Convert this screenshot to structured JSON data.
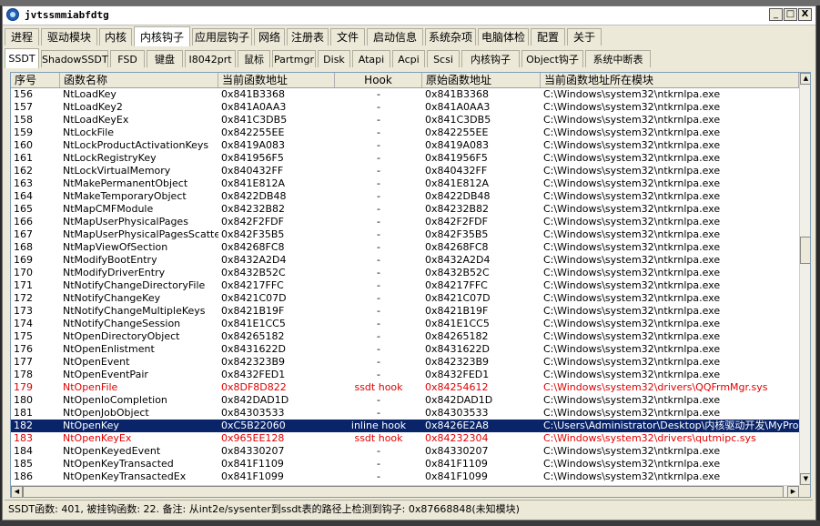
{
  "window": {
    "title": "jvtssmmiabfdtg"
  },
  "menu_tabs": [
    "进程",
    "驱动模块",
    "内核",
    "内核钩子",
    "应用层钩子",
    "网络",
    "注册表",
    "文件",
    "启动信息",
    "系统杂项",
    "电脑体检",
    "配置",
    "关于"
  ],
  "active_menu_tab": "内核钩子",
  "sub_tabs": [
    "SSDT",
    "ShadowSSDT",
    "FSD",
    "键盘",
    "I8042prt",
    "鼠标",
    "Partmgr",
    "Disk",
    "Atapi",
    "Acpi",
    "Scsi",
    "内核钩子",
    "Object钩子",
    "系统中断表"
  ],
  "active_sub_tab": "SSDT",
  "columns": [
    "序号",
    "函数名称",
    "当前函数地址",
    "Hook",
    "原始函数地址",
    "当前函数地址所在模块"
  ],
  "rows": [
    {
      "idx": "156",
      "name": "NtLoadKey",
      "cur": "0x841B3368",
      "hook": "-",
      "orig": "0x841B3368",
      "module": "C:\\Windows\\system32\\ntkrnlpa.exe",
      "state": "normal"
    },
    {
      "idx": "157",
      "name": "NtLoadKey2",
      "cur": "0x841A0AA3",
      "hook": "-",
      "orig": "0x841A0AA3",
      "module": "C:\\Windows\\system32\\ntkrnlpa.exe",
      "state": "normal"
    },
    {
      "idx": "158",
      "name": "NtLoadKeyEx",
      "cur": "0x841C3DB5",
      "hook": "-",
      "orig": "0x841C3DB5",
      "module": "C:\\Windows\\system32\\ntkrnlpa.exe",
      "state": "normal"
    },
    {
      "idx": "159",
      "name": "NtLockFile",
      "cur": "0x842255EE",
      "hook": "-",
      "orig": "0x842255EE",
      "module": "C:\\Windows\\system32\\ntkrnlpa.exe",
      "state": "normal"
    },
    {
      "idx": "160",
      "name": "NtLockProductActivationKeys",
      "cur": "0x8419A083",
      "hook": "-",
      "orig": "0x8419A083",
      "module": "C:\\Windows\\system32\\ntkrnlpa.exe",
      "state": "normal"
    },
    {
      "idx": "161",
      "name": "NtLockRegistryKey",
      "cur": "0x841956F5",
      "hook": "-",
      "orig": "0x841956F5",
      "module": "C:\\Windows\\system32\\ntkrnlpa.exe",
      "state": "normal"
    },
    {
      "idx": "162",
      "name": "NtLockVirtualMemory",
      "cur": "0x840432FF",
      "hook": "-",
      "orig": "0x840432FF",
      "module": "C:\\Windows\\system32\\ntkrnlpa.exe",
      "state": "normal"
    },
    {
      "idx": "163",
      "name": "NtMakePermanentObject",
      "cur": "0x841E812A",
      "hook": "-",
      "orig": "0x841E812A",
      "module": "C:\\Windows\\system32\\ntkrnlpa.exe",
      "state": "normal"
    },
    {
      "idx": "164",
      "name": "NtMakeTemporaryObject",
      "cur": "0x8422DB48",
      "hook": "-",
      "orig": "0x8422DB48",
      "module": "C:\\Windows\\system32\\ntkrnlpa.exe",
      "state": "normal"
    },
    {
      "idx": "165",
      "name": "NtMapCMFModule",
      "cur": "0x84232B82",
      "hook": "-",
      "orig": "0x84232B82",
      "module": "C:\\Windows\\system32\\ntkrnlpa.exe",
      "state": "normal"
    },
    {
      "idx": "166",
      "name": "NtMapUserPhysicalPages",
      "cur": "0x842F2FDF",
      "hook": "-",
      "orig": "0x842F2FDF",
      "module": "C:\\Windows\\system32\\ntkrnlpa.exe",
      "state": "normal"
    },
    {
      "idx": "167",
      "name": "NtMapUserPhysicalPagesScatter",
      "cur": "0x842F35B5",
      "hook": "-",
      "orig": "0x842F35B5",
      "module": "C:\\Windows\\system32\\ntkrnlpa.exe",
      "state": "normal"
    },
    {
      "idx": "168",
      "name": "NtMapViewOfSection",
      "cur": "0x84268FC8",
      "hook": "-",
      "orig": "0x84268FC8",
      "module": "C:\\Windows\\system32\\ntkrnlpa.exe",
      "state": "normal"
    },
    {
      "idx": "169",
      "name": "NtModifyBootEntry",
      "cur": "0x8432A2D4",
      "hook": "-",
      "orig": "0x8432A2D4",
      "module": "C:\\Windows\\system32\\ntkrnlpa.exe",
      "state": "normal"
    },
    {
      "idx": "170",
      "name": "NtModifyDriverEntry",
      "cur": "0x8432B52C",
      "hook": "-",
      "orig": "0x8432B52C",
      "module": "C:\\Windows\\system32\\ntkrnlpa.exe",
      "state": "normal"
    },
    {
      "idx": "171",
      "name": "NtNotifyChangeDirectoryFile",
      "cur": "0x84217FFC",
      "hook": "-",
      "orig": "0x84217FFC",
      "module": "C:\\Windows\\system32\\ntkrnlpa.exe",
      "state": "normal"
    },
    {
      "idx": "172",
      "name": "NtNotifyChangeKey",
      "cur": "0x8421C07D",
      "hook": "-",
      "orig": "0x8421C07D",
      "module": "C:\\Windows\\system32\\ntkrnlpa.exe",
      "state": "normal"
    },
    {
      "idx": "173",
      "name": "NtNotifyChangeMultipleKeys",
      "cur": "0x8421B19F",
      "hook": "-",
      "orig": "0x8421B19F",
      "module": "C:\\Windows\\system32\\ntkrnlpa.exe",
      "state": "normal"
    },
    {
      "idx": "174",
      "name": "NtNotifyChangeSession",
      "cur": "0x841E1CC5",
      "hook": "-",
      "orig": "0x841E1CC5",
      "module": "C:\\Windows\\system32\\ntkrnlpa.exe",
      "state": "normal"
    },
    {
      "idx": "175",
      "name": "NtOpenDirectoryObject",
      "cur": "0x84265182",
      "hook": "-",
      "orig": "0x84265182",
      "module": "C:\\Windows\\system32\\ntkrnlpa.exe",
      "state": "normal"
    },
    {
      "idx": "176",
      "name": "NtOpenEnlistment",
      "cur": "0x8431622D",
      "hook": "-",
      "orig": "0x8431622D",
      "module": "C:\\Windows\\system32\\ntkrnlpa.exe",
      "state": "normal"
    },
    {
      "idx": "177",
      "name": "NtOpenEvent",
      "cur": "0x842323B9",
      "hook": "-",
      "orig": "0x842323B9",
      "module": "C:\\Windows\\system32\\ntkrnlpa.exe",
      "state": "normal"
    },
    {
      "idx": "178",
      "name": "NtOpenEventPair",
      "cur": "0x8432FED1",
      "hook": "-",
      "orig": "0x8432FED1",
      "module": "C:\\Windows\\system32\\ntkrnlpa.exe",
      "state": "normal"
    },
    {
      "idx": "179",
      "name": "NtOpenFile",
      "cur": "0x8DF8D822",
      "hook": "ssdt hook",
      "orig": "0x84254612",
      "module": "C:\\Windows\\system32\\drivers\\QQFrmMgr.sys",
      "state": "hooked"
    },
    {
      "idx": "180",
      "name": "NtOpenIoCompletion",
      "cur": "0x842DAD1D",
      "hook": "-",
      "orig": "0x842DAD1D",
      "module": "C:\\Windows\\system32\\ntkrnlpa.exe",
      "state": "normal"
    },
    {
      "idx": "181",
      "name": "NtOpenJobObject",
      "cur": "0x84303533",
      "hook": "-",
      "orig": "0x84303533",
      "module": "C:\\Windows\\system32\\ntkrnlpa.exe",
      "state": "normal"
    },
    {
      "idx": "182",
      "name": "NtOpenKey",
      "cur": "0xC5B22060",
      "hook": "inline hook",
      "orig": "0x8426E2A8",
      "module": "C:\\Users\\Administrator\\Desktop\\内核驱动开发\\MyPro...",
      "state": "selected"
    },
    {
      "idx": "183",
      "name": "NtOpenKeyEx",
      "cur": "0x965EE128",
      "hook": "ssdt hook",
      "orig": "0x84232304",
      "module": "C:\\Windows\\system32\\drivers\\qutmipc.sys",
      "state": "hooked"
    },
    {
      "idx": "184",
      "name": "NtOpenKeyedEvent",
      "cur": "0x84330207",
      "hook": "-",
      "orig": "0x84330207",
      "module": "C:\\Windows\\system32\\ntkrnlpa.exe",
      "state": "normal"
    },
    {
      "idx": "185",
      "name": "NtOpenKeyTransacted",
      "cur": "0x841F1109",
      "hook": "-",
      "orig": "0x841F1109",
      "module": "C:\\Windows\\system32\\ntkrnlpa.exe",
      "state": "normal"
    },
    {
      "idx": "186",
      "name": "NtOpenKeyTransactedEx",
      "cur": "0x841F1099",
      "hook": "-",
      "orig": "0x841F1099",
      "module": "C:\\Windows\\system32\\ntkrnlpa.exe",
      "state": "normal"
    }
  ],
  "status": "SSDT函数: 401, 被挂钩函数: 22. 备注: 从int2e/sysenter到ssdt表的路径上检测到钩子: 0x87668848(未知模块)",
  "colors": {
    "hook_red": "#e00000",
    "selection": "#0a246a"
  }
}
